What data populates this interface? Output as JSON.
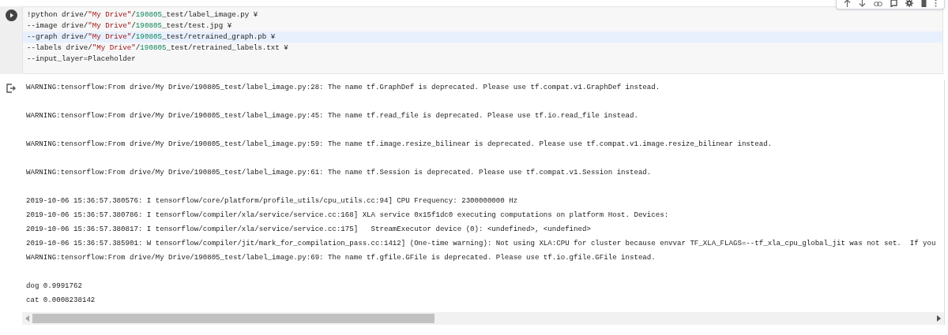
{
  "code_cell": {
    "lines": [
      {
        "highlighted": false,
        "tokens": [
          {
            "kind": "plain",
            "text": "!python drive/"
          },
          {
            "kind": "string",
            "text": "\"My Drive\""
          },
          {
            "kind": "plain",
            "text": "/"
          },
          {
            "kind": "number",
            "text": "190805"
          },
          {
            "kind": "plain",
            "text": "_test/label_image.py ¥"
          }
        ]
      },
      {
        "highlighted": false,
        "tokens": [
          {
            "kind": "plain",
            "text": "--image drive/"
          },
          {
            "kind": "string",
            "text": "\"My Drive\""
          },
          {
            "kind": "plain",
            "text": "/"
          },
          {
            "kind": "number",
            "text": "190805"
          },
          {
            "kind": "plain",
            "text": "_test/test.jpg ¥"
          }
        ]
      },
      {
        "highlighted": true,
        "tokens": [
          {
            "kind": "plain",
            "text": "--graph drive/"
          },
          {
            "kind": "string",
            "text": "\"My Drive\""
          },
          {
            "kind": "plain",
            "text": "/"
          },
          {
            "kind": "number",
            "text": "190805"
          },
          {
            "kind": "plain",
            "text": "_test/retrained_graph.pb ¥"
          }
        ]
      },
      {
        "highlighted": false,
        "tokens": [
          {
            "kind": "plain",
            "text": "--labels drive/"
          },
          {
            "kind": "string",
            "text": "\"My Drive\""
          },
          {
            "kind": "plain",
            "text": "/"
          },
          {
            "kind": "number",
            "text": "190805"
          },
          {
            "kind": "plain",
            "text": "_test/retrained_labels.txt ¥"
          }
        ]
      },
      {
        "highlighted": false,
        "tokens": [
          {
            "kind": "plain",
            "text": "--input_layer=Placeholder"
          }
        ]
      }
    ]
  },
  "output": {
    "blocks": [
      [
        "WARNING:tensorflow:From drive/My Drive/190805_test/label_image.py:28: The name tf.GraphDef is deprecated. Please use tf.compat.v1.GraphDef instead."
      ],
      [
        "WARNING:tensorflow:From drive/My Drive/190805_test/label_image.py:45: The name tf.read_file is deprecated. Please use tf.io.read_file instead."
      ],
      [
        "WARNING:tensorflow:From drive/My Drive/190805_test/label_image.py:59: The name tf.image.resize_bilinear is deprecated. Please use tf.compat.v1.image.resize_bilinear instead."
      ],
      [
        "WARNING:tensorflow:From drive/My Drive/190805_test/label_image.py:61: The name tf.Session is deprecated. Please use tf.compat.v1.Session instead."
      ],
      [
        "2019-10-06 15:36:57.380576: I tensorflow/core/platform/profile_utils/cpu_utils.cc:94] CPU Frequency: 2300000000 Hz",
        "2019-10-06 15:36:57.380786: I tensorflow/compiler/xla/service/service.cc:168] XLA service 0x15f1dc0 executing computations on platform Host. Devices:",
        "2019-10-06 15:36:57.380817: I tensorflow/compiler/xla/service/service.cc:175]   StreamExecutor device (0): <undefined>, <undefined>",
        "2019-10-06 15:36:57.385901: W tensorflow/compiler/jit/mark_for_compilation_pass.cc:1412] (One-time warning): Not using XLA:CPU for cluster because envvar TF_XLA_FLAGS=--tf_xla_cpu_global_jit was not set.  If you",
        "WARNING:tensorflow:From drive/My Drive/190805_test/label_image.py:69: The name tf.gfile.GFile is deprecated. Please use tf.io.gfile.GFile instead."
      ],
      [
        "dog 0.9991762",
        "cat 0.0008238142"
      ]
    ]
  }
}
